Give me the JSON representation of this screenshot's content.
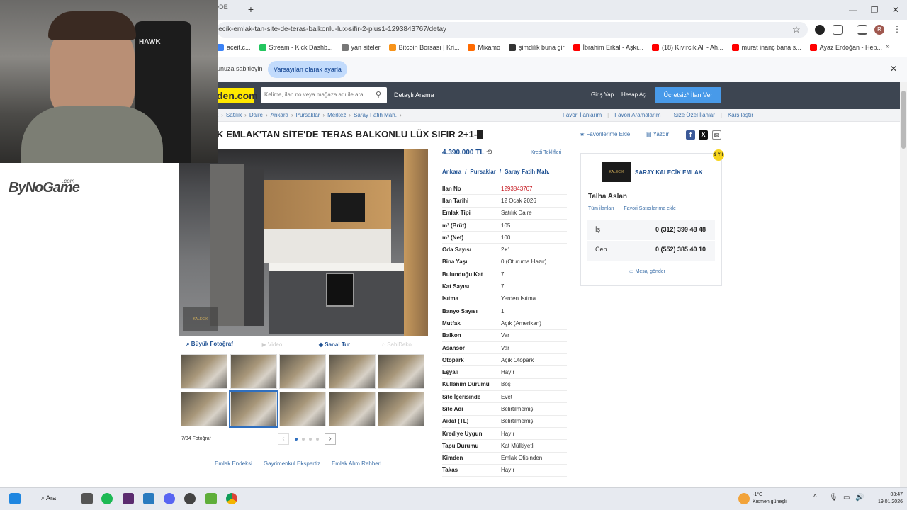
{
  "browser": {
    "tab_fragment": "•DE",
    "url": "lecik-emlak-tan-site-de-teras-balkonlu-lux-sifir-2-plus1-1293843767/detay",
    "bookmarks": [
      {
        "label": "aceit.c...",
        "color": "#3b82f6"
      },
      {
        "label": "Stream - Kick Dashb...",
        "color": "#22c55e"
      },
      {
        "label": "yan siteler",
        "color": "#777777"
      },
      {
        "label": "Bitcoin Borsası | Kri...",
        "color": "#f7931a"
      },
      {
        "label": "Mixamo",
        "color": "#ff6a00"
      },
      {
        "label": "şimdilik buna gir",
        "color": "#333333"
      },
      {
        "label": "İbrahim Erkal - Aşkı...",
        "color": "#ff0000"
      },
      {
        "label": "(18) Kıvırcık Ali - Ah...",
        "color": "#ff0000"
      },
      {
        "label": "murat inanç bana s...",
        "color": "#ff0000"
      },
      {
        "label": "Ayaz Erdoğan - Hep...",
        "color": "#ff0000"
      }
    ],
    "infobar_text": "unuza sabitleyin",
    "infobar_button": "Varsayılan olarak ayarla"
  },
  "site": {
    "logo": "den.com",
    "search_placeholder": "Kelime, ilan no veya mağaza adı ile ara",
    "advanced_search": "Detaylı Arama",
    "login": "Giriş Yap",
    "register": "Hesap Aç",
    "post_ad": "Ücretsiz* İlan Ver"
  },
  "breadcrumb": [
    "t",
    "Satılık",
    "Daire",
    "Ankara",
    "Pursaklar",
    "Merkez",
    "Saray Fatih Mah."
  ],
  "breadcrumb_right": [
    "Favori İlanlarım",
    "Favori Aramalarım",
    "Size Özel İlanlar",
    "Karşılaştır"
  ],
  "listing": {
    "title": "K EMLAK'TAN SİTE'DE TERAS BALKONLU LÜX SIFIR 2+1-",
    "favorite": "Favorilerime Ekle",
    "print": "Yazdır",
    "price": "4.390.000 TL",
    "credit": "Kredi Teklifleri",
    "location": [
      "Ankara",
      "Pursaklar",
      "Saray Fatih Mah."
    ],
    "details": [
      {
        "k": "İlan No",
        "v": "1293843767",
        "red": true
      },
      {
        "k": "İlan Tarihi",
        "v": "12 Ocak 2026"
      },
      {
        "k": "Emlak Tipi",
        "v": "Satılık Daire"
      },
      {
        "k": "m² (Brüt)",
        "v": "105"
      },
      {
        "k": "m² (Net)",
        "v": "100"
      },
      {
        "k": "Oda Sayısı",
        "v": "2+1"
      },
      {
        "k": "Bina Yaşı",
        "v": "0 (Oturuma Hazır)"
      },
      {
        "k": "Bulunduğu Kat",
        "v": "7"
      },
      {
        "k": "Kat Sayısı",
        "v": "7"
      },
      {
        "k": "Isıtma",
        "v": "Yerden Isıtma"
      },
      {
        "k": "Banyo Sayısı",
        "v": "1"
      },
      {
        "k": "Mutfak",
        "v": "Açık (Amerikan)"
      },
      {
        "k": "Balkon",
        "v": "Var"
      },
      {
        "k": "Asansör",
        "v": "Var"
      },
      {
        "k": "Otopark",
        "v": "Açık Otopark"
      },
      {
        "k": "Eşyalı",
        "v": "Hayır"
      },
      {
        "k": "Kullanım Durumu",
        "v": "Boş"
      },
      {
        "k": "Site İçerisinde",
        "v": "Evet"
      },
      {
        "k": "Site Adı",
        "v": "Belirtilmemiş"
      },
      {
        "k": "Aidat (TL)",
        "v": "Belirtilmemiş"
      },
      {
        "k": "Krediye Uygun",
        "v": "Hayır"
      },
      {
        "k": "Tapu Durumu",
        "v": "Kat Mülkiyetli"
      },
      {
        "k": "Kimden",
        "v": "Emlak Ofisinden"
      },
      {
        "k": "Takas",
        "v": "Hayır"
      }
    ]
  },
  "gallery": {
    "big_photo": "Büyük Fotoğraf",
    "video": "Video",
    "virtual_tour": "Sanal Tur",
    "decor": "SahiDeko",
    "counter": "7/34 Fotoğraf",
    "selected_thumb_index": 6
  },
  "footer_links": [
    "Emlak Endeksi",
    "Gayrimenkul Ekspertiz",
    "Emlak Alım Rehberi"
  ],
  "seller": {
    "logo_text": "KALECİK",
    "store": "SARAY KALECİK EMLAK",
    "badge": "9 Yıl",
    "agent": "Talha Aslan",
    "all_ads": "Tüm ilanları",
    "add_fav": "Favori Satıcılarıma ekle",
    "work_label": "İş",
    "work_phone": "0 (312) 399 48 48",
    "cell_label": "Cep",
    "cell_phone": "0 (552) 385 40 10",
    "message": "Mesaj gönder"
  },
  "overlay": {
    "watermark": "ByNoGame",
    "watermark_sub": ".com",
    "webcam_brand": "HAWK"
  },
  "taskbar": {
    "search": "Ara",
    "temp": "-1°C",
    "weather": "Kısmen güneşli",
    "time": "03:47",
    "date": "19.01.2026"
  }
}
